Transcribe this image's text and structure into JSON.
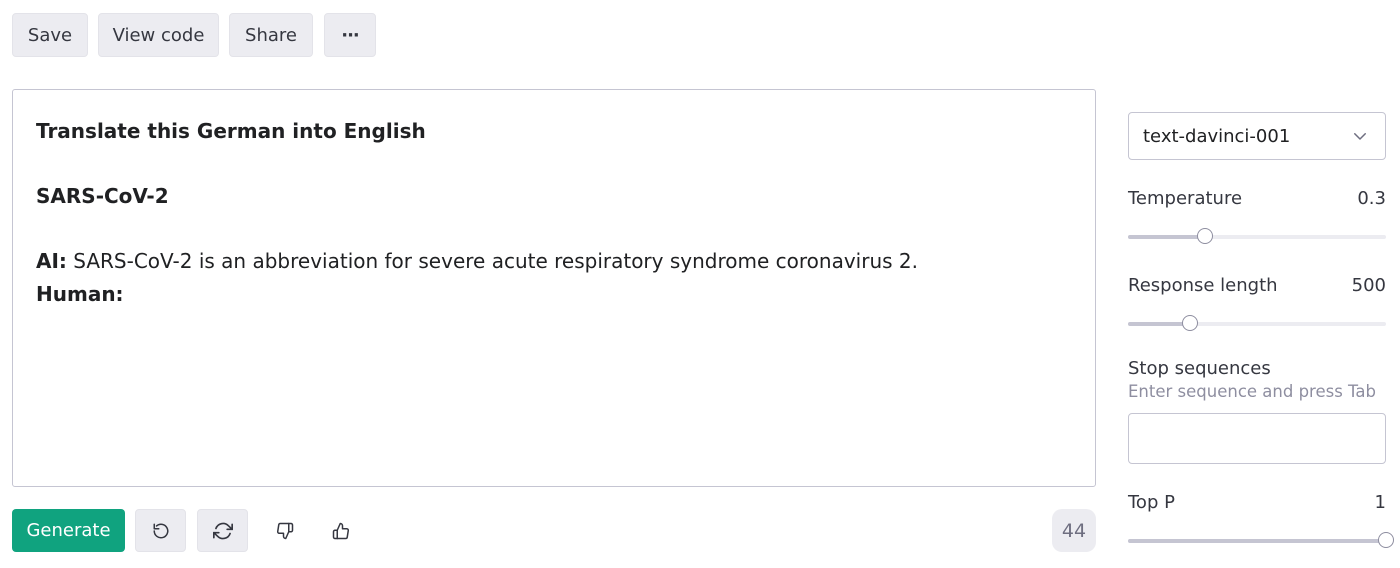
{
  "toolbar": {
    "save_label": "Save",
    "view_code_label": "View code",
    "share_label": "Share",
    "more_label": "···"
  },
  "prompt": {
    "title": "Translate this German into English",
    "input": "SARS-CoV-2",
    "ai_speaker": "AI:",
    "ai_text": " SARS-CoV-2 is an abbreviation for severe acute respiratory syndrome coronavirus 2.",
    "human_speaker": "Human:"
  },
  "actions": {
    "generate_label": "Generate",
    "undo_icon": "undo-icon",
    "regenerate_icon": "regenerate-icon",
    "thumbs_down_icon": "thumbs-down-icon",
    "thumbs_up_icon": "thumbs-up-icon",
    "token_count": "44"
  },
  "settings": {
    "model": "text-davinci-001",
    "temperature": {
      "label": "Temperature",
      "value": "0.3",
      "level": 0.3
    },
    "response_length": {
      "label": "Response length",
      "value": "500",
      "level": 0.24
    },
    "stop_sequences": {
      "label": "Stop sequences",
      "hint": "Enter sequence and press Tab",
      "value": ""
    },
    "top_p": {
      "label": "Top P",
      "value": "1",
      "level": 1.0
    }
  },
  "colors": {
    "primary": "#10a37f",
    "button_bg": "#ececf1",
    "border": "#c5c5d2",
    "text": "#202123",
    "muted": "#8e8ea0"
  }
}
